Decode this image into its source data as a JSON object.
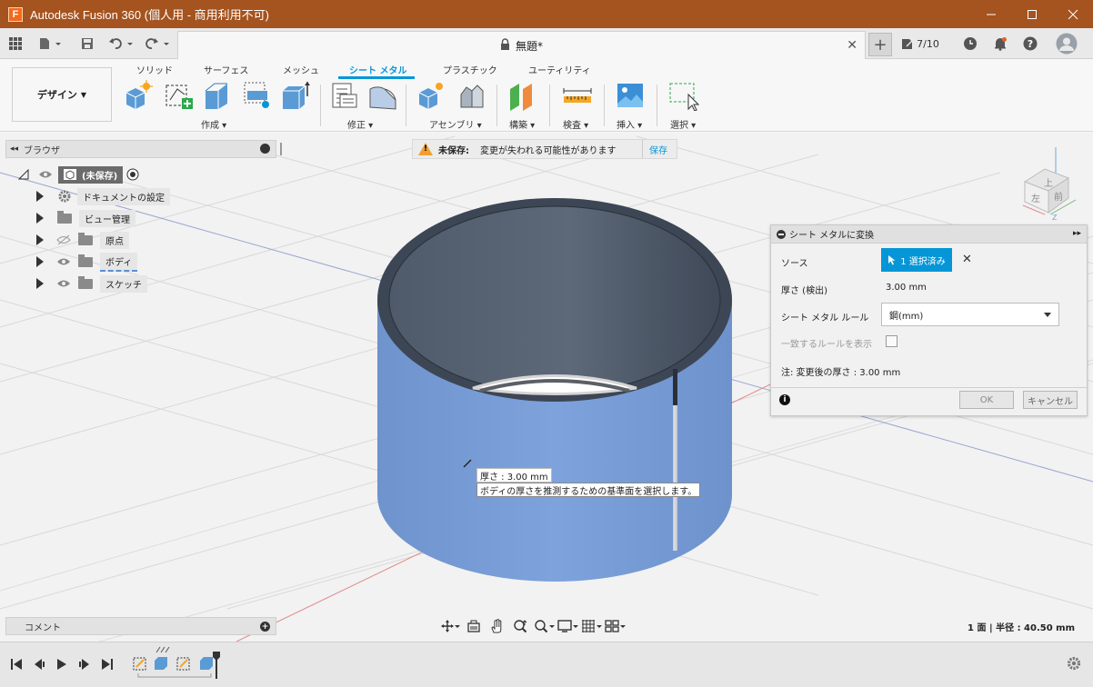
{
  "window": {
    "title": "Autodesk Fusion 360 (個人用 - 商用利用不可)",
    "app_icon_letter": "F"
  },
  "top_toolbar": {
    "document_title": "無題*",
    "job_status": "7/10"
  },
  "ribbon": {
    "design_button": "デザイン",
    "tabs": [
      "ソリッド",
      "サーフェス",
      "メッシュ",
      "シート メタル",
      "プラスチック",
      "ユーティリティ"
    ],
    "active_tab": "シート メタル",
    "groups": [
      "作成",
      "修正",
      "アセンブリ",
      "構築",
      "検査",
      "挿入",
      "選択"
    ]
  },
  "browser": {
    "title": "ブラウザ",
    "root": "(未保存)",
    "items": [
      {
        "label": "ドキュメントの設定"
      },
      {
        "label": "ビュー管理"
      },
      {
        "label": "原点"
      },
      {
        "label": "ボディ"
      },
      {
        "label": "スケッチ"
      }
    ]
  },
  "banner": {
    "label": "未保存:",
    "message": "変更が失われる可能性があります",
    "action": "保存"
  },
  "viewcube": {
    "top": "上",
    "front": "前",
    "left": "左"
  },
  "dialog": {
    "title": "シート メタルに変換",
    "source_label": "ソース",
    "source_button": "1 選択済み",
    "thickness_label": "厚さ (検出)",
    "thickness_value": "3.00 mm",
    "rule_label": "シート メタル ルール",
    "rule_value": "鋼(mm)",
    "match_label": "一致するルールを表示",
    "note": "注: 変更後の厚さ : 3.00 mm",
    "ok": "OK",
    "cancel": "キャンセル"
  },
  "tooltip": {
    "thickness": "厚さ : 3.00 mm",
    "hint": "ボディの厚さを推測するための基準面を選択します。"
  },
  "comment_bar": {
    "label": "コメント"
  },
  "status": {
    "text": "1 面 | 半径 : 40.50 mm"
  },
  "colors": {
    "accent": "#0696d7",
    "titlebar": "#a5531f",
    "body_blue": "#7499d4"
  }
}
